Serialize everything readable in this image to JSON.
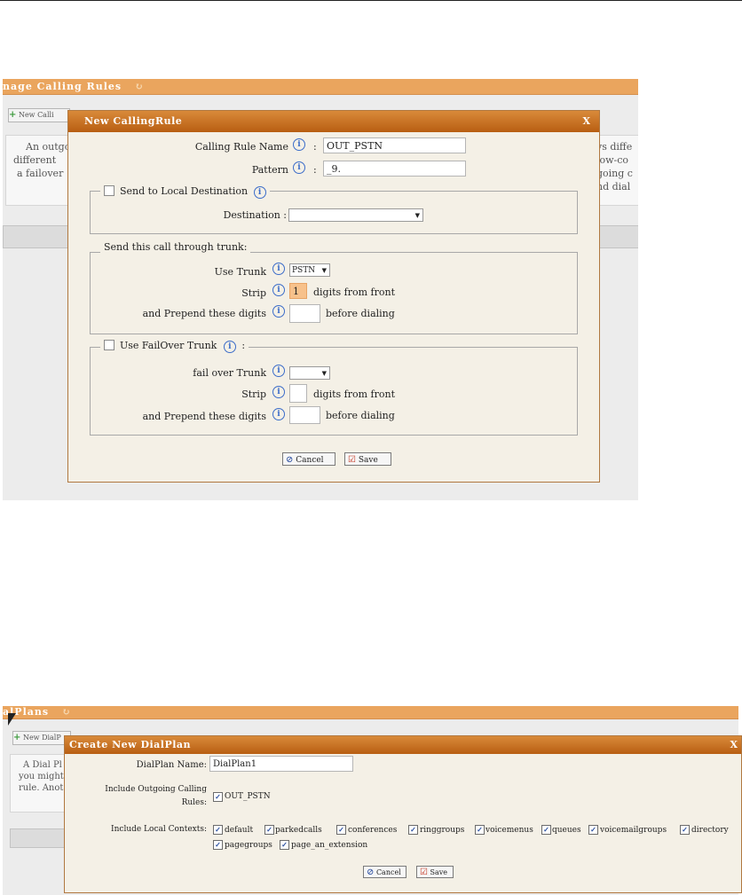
{
  "rule_screen": {
    "header": "nage Calling Rules",
    "new_button": "New Calli",
    "desc_left": [
      "An outgo",
      "different",
      "a failover"
    ],
    "desc_right": [
      "vs diffe",
      "low-co",
      "going c",
      "nd dial"
    ]
  },
  "rule_dialog": {
    "title": "New CallingRule",
    "close": "X",
    "name_label": "Calling Rule Name",
    "name_value": "OUT_PSTN",
    "pattern_label": "Pattern",
    "pattern_value": "_9.",
    "colon": ":",
    "local_legend": "Send to Local Destination",
    "destination_label": "Destination :",
    "destination_value": "",
    "trunk_legend": "Send this call through trunk:",
    "use_trunk_label": "Use Trunk",
    "use_trunk_value": "PSTN",
    "strip_label": "Strip",
    "strip_value": "1",
    "digits_from_front": "digits from front",
    "prepend_label": "and Prepend these digits",
    "prepend_value": "",
    "before_dialing": "before dialing",
    "failover_legend": "Use FailOver Trunk",
    "failover_trunk_label": "fail over Trunk",
    "failover_trunk_value": "",
    "fo_strip_label": "Strip",
    "fo_strip_value": "",
    "fo_digits_from_front": "digits from front",
    "fo_prepend_label": "and Prepend these digits",
    "fo_prepend_value": "",
    "fo_before_dialing": "before dialing",
    "cancel": "Cancel",
    "save": "Save"
  },
  "plan_screen": {
    "header": "alPlans",
    "new_button": "New DialP",
    "desc_left": [
      "A Dial Pl",
      "you might",
      "rule. Anot"
    ]
  },
  "plan_dialog": {
    "title": "Create New DialPlan",
    "close": "X",
    "name_label": "DialPlan Name:",
    "name_value": "DialPlan1",
    "outgoing_label_1": "Include Outgoing Calling",
    "outgoing_label_2": "Rules:",
    "outgoing_rule": "OUT_PSTN",
    "contexts_label": "Include Local Contexts:",
    "contexts": [
      "default",
      "parkedcalls",
      "conferences",
      "ringgroups",
      "voicemenus",
      "queues",
      "voicemailgroups",
      "directory",
      "pagegroups",
      "page_an_extension"
    ],
    "cancel": "Cancel",
    "save": "Save"
  }
}
